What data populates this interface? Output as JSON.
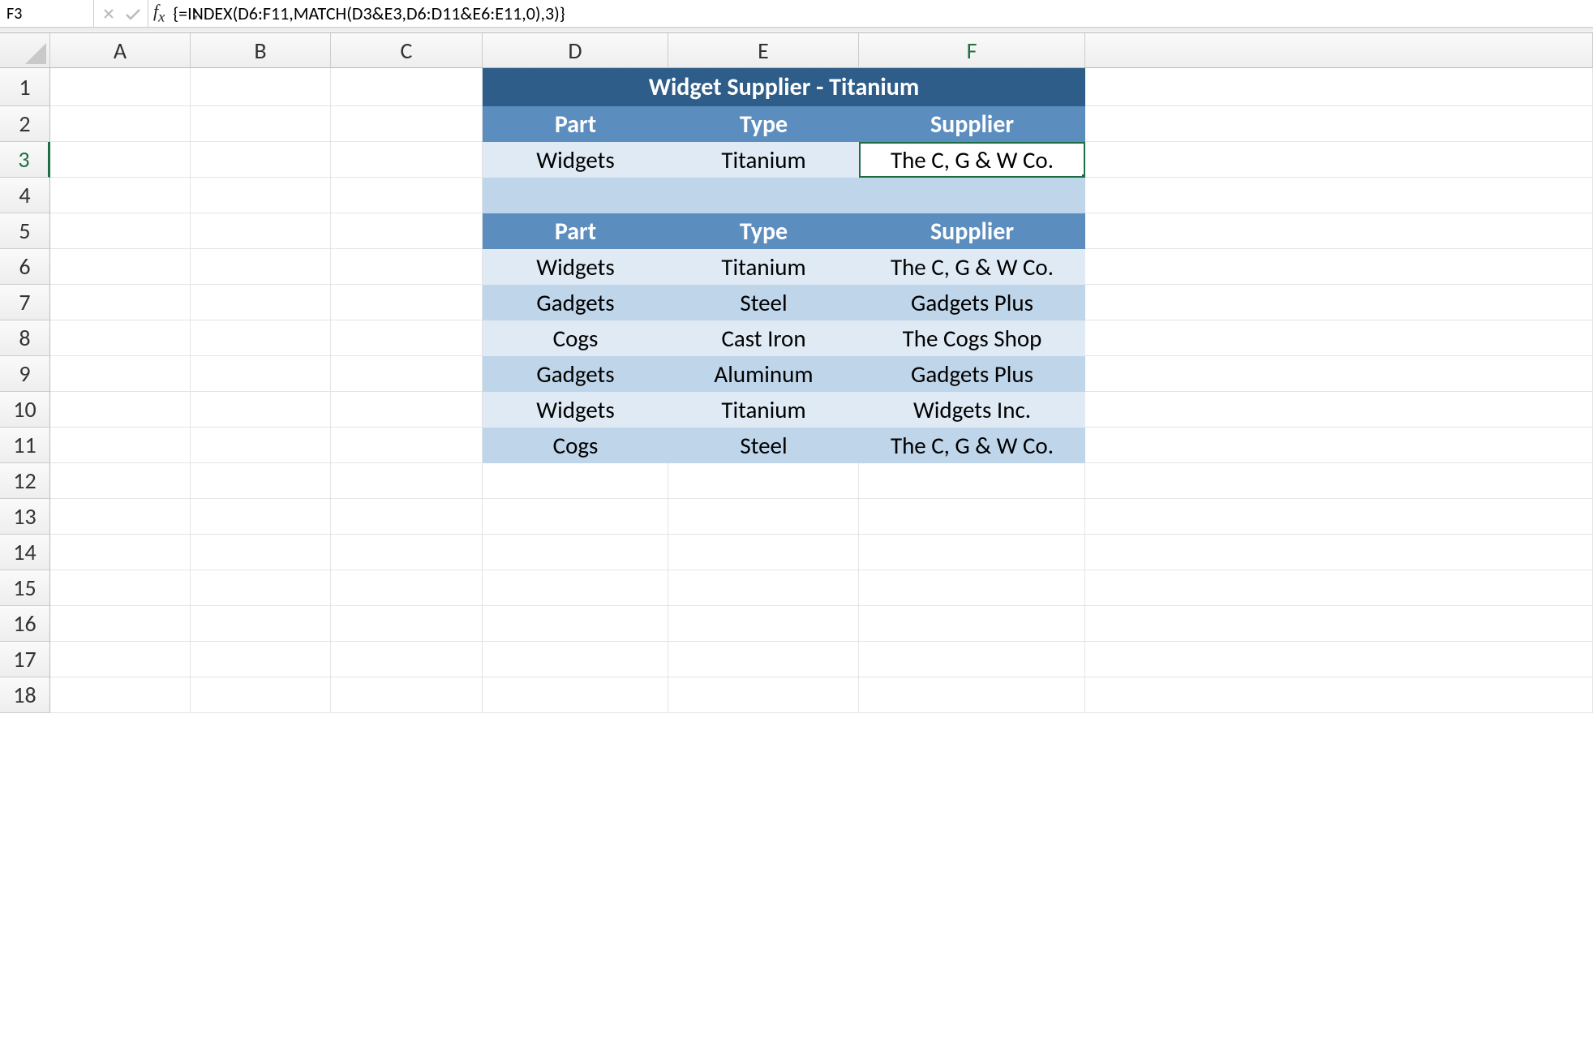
{
  "formula_bar": {
    "name_box": "F3",
    "formula": "{=INDEX(D6:F11,MATCH(D3&E3,D6:D11&E6:E11,0),3)}"
  },
  "columns": [
    "A",
    "B",
    "C",
    "D",
    "E",
    "F"
  ],
  "active_column": "F",
  "active_row": "3",
  "rows": [
    "1",
    "2",
    "3",
    "4",
    "5",
    "6",
    "7",
    "8",
    "9",
    "10",
    "11",
    "12",
    "13",
    "14",
    "15",
    "16",
    "17",
    "18"
  ],
  "table1": {
    "title": "Widget Supplier - Titanium",
    "headers": {
      "d": "Part",
      "e": "Type",
      "f": "Supplier"
    },
    "values": {
      "d": "Widgets",
      "e": "Titanium",
      "f": "The C, G & W Co."
    }
  },
  "table2": {
    "headers": {
      "d": "Part",
      "e": "Type",
      "f": "Supplier"
    },
    "rows": [
      {
        "d": "Widgets",
        "e": "Titanium",
        "f": "The C, G & W Co."
      },
      {
        "d": "Gadgets",
        "e": "Steel",
        "f": "Gadgets Plus"
      },
      {
        "d": "Cogs",
        "e": "Cast Iron",
        "f": "The Cogs Shop"
      },
      {
        "d": "Gadgets",
        "e": "Aluminum",
        "f": "Gadgets Plus"
      },
      {
        "d": "Widgets",
        "e": "Titanium",
        "f": "Widgets Inc."
      },
      {
        "d": "Cogs",
        "e": "Steel",
        "f": "The C, G & W Co."
      }
    ]
  }
}
